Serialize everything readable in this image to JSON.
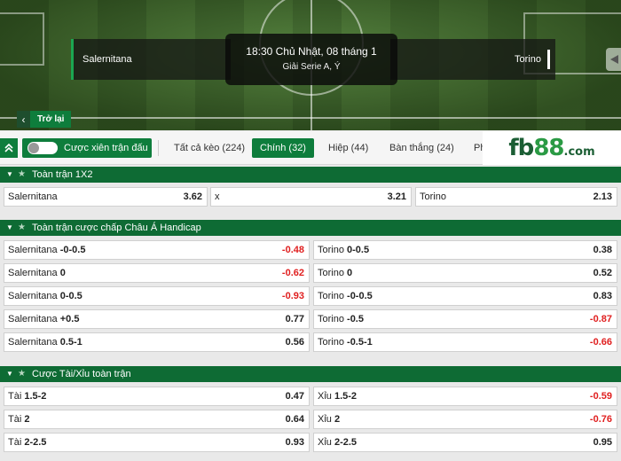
{
  "match": {
    "home_team": "Salernitana",
    "away_team": "Torino",
    "datetime": "18:30 Chủ Nhật, 08 tháng 1",
    "league": "Giải Serie A, Ý"
  },
  "back_label": "Trở lại",
  "parlay_label": "Cược xiên trận đấu",
  "tabs": [
    {
      "label": "Tất cả kèo (224)",
      "active": false
    },
    {
      "label": "Chính (32)",
      "active": true
    },
    {
      "label": "Hiệp (44)",
      "active": false
    },
    {
      "label": "Bàn thắng (24)",
      "active": false
    },
    {
      "label": "Ph",
      "active": false
    }
  ],
  "logo": {
    "part1": "fb",
    "part2": "88",
    "part3": ".com"
  },
  "sections": [
    {
      "title": "Toàn trận 1X2",
      "rows": [
        [
          {
            "label": "Salernitana",
            "odd": "3.62"
          },
          {
            "label": "x",
            "odd": "3.21"
          },
          {
            "label": "Torino",
            "odd": "2.13"
          }
        ]
      ]
    },
    {
      "title": "Toàn trận cược chấp Châu Á Handicap",
      "rows": [
        [
          {
            "label": "Salernitana",
            "line": "-0-0.5",
            "odd": "-0.48"
          },
          {
            "label": "Torino",
            "line": "0-0.5",
            "odd": "0.38"
          }
        ],
        [
          {
            "label": "Salernitana",
            "line": "0",
            "odd": "-0.62"
          },
          {
            "label": "Torino",
            "line": "0",
            "odd": "0.52"
          }
        ],
        [
          {
            "label": "Salernitana",
            "line": "0-0.5",
            "odd": "-0.93"
          },
          {
            "label": "Torino",
            "line": "-0-0.5",
            "odd": "0.83"
          }
        ],
        [
          {
            "label": "Salernitana",
            "line": "+0.5",
            "odd": "0.77"
          },
          {
            "label": "Torino",
            "line": "-0.5",
            "odd": "-0.87"
          }
        ],
        [
          {
            "label": "Salernitana",
            "line": "0.5-1",
            "odd": "0.56"
          },
          {
            "label": "Torino",
            "line": "-0.5-1",
            "odd": "-0.66"
          }
        ]
      ]
    },
    {
      "title": "Cược Tài/Xỉu toàn trận",
      "rows": [
        [
          {
            "label": "Tài",
            "line": "1.5-2",
            "odd": "0.47"
          },
          {
            "label": "Xỉu",
            "line": "1.5-2",
            "odd": "-0.59"
          }
        ],
        [
          {
            "label": "Tài",
            "line": "2",
            "odd": "0.64"
          },
          {
            "label": "Xỉu",
            "line": "2",
            "odd": "-0.76"
          }
        ],
        [
          {
            "label": "Tài",
            "line": "2-2.5",
            "odd": "0.93"
          },
          {
            "label": "Xỉu",
            "line": "2-2.5",
            "odd": "0.95"
          }
        ]
      ]
    }
  ],
  "colors": {
    "brand_green": "#0e7d3c",
    "section_green": "#0e6b34",
    "negative_odd": "#e02020"
  },
  "icons": {
    "collapse": "chevron-double-up-icon",
    "back": "chevron-left-icon",
    "share": "share-icon",
    "caret": "caret-down-icon",
    "star": "star-icon"
  }
}
